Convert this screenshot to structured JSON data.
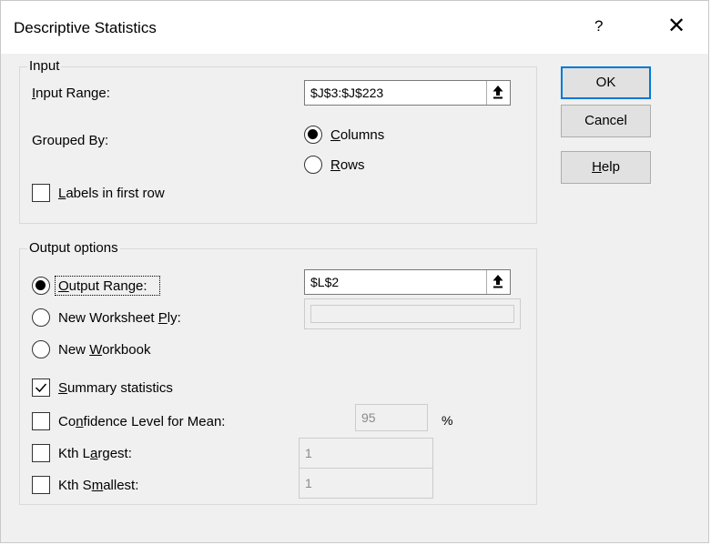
{
  "window": {
    "title": "Descriptive Statistics",
    "help_glyph": "?",
    "close_glyph": "✕"
  },
  "input_group": {
    "caption": "Input",
    "input_range_label_pre": "",
    "input_range_label_u": "I",
    "input_range_label_post": "nput Range:",
    "input_range_value": "$J$3:$J$223",
    "grouped_by_label": "Grouped By:",
    "columns_label_u": "C",
    "columns_label_post": "olumns",
    "columns_checked": true,
    "rows_label_u": "R",
    "rows_label_post": "ows",
    "rows_checked": false,
    "labels_label_u": "L",
    "labels_label_post": "abels in first row",
    "labels_checked": false
  },
  "output_group": {
    "caption": "Output options",
    "output_range_label_u": "O",
    "output_range_label_post": "utput Range:",
    "output_range_checked": true,
    "output_range_value": "$L$2",
    "new_ply_label_pre": "New Worksheet ",
    "new_ply_label_u": "P",
    "new_ply_label_post": "ly:",
    "new_ply_checked": false,
    "new_ply_value": "",
    "new_workbook_label_pre": "New ",
    "new_workbook_label_u": "W",
    "new_workbook_label_post": "orkbook",
    "new_workbook_checked": false,
    "summary_label_u": "S",
    "summary_label_post": "ummary statistics",
    "summary_checked": true,
    "confidence_label_pre": "Co",
    "confidence_label_u": "n",
    "confidence_label_post": "fidence Level for Mean:",
    "confidence_checked": false,
    "confidence_value": "95",
    "percent_sign": "%",
    "kth_largest_label_pre": "Kth L",
    "kth_largest_label_u": "a",
    "kth_largest_label_post": "rgest:",
    "kth_largest_checked": false,
    "kth_largest_value": "1",
    "kth_smallest_label_pre": "Kth S",
    "kth_smallest_label_u": "m",
    "kth_smallest_label_post": "allest:",
    "kth_smallest_checked": false,
    "kth_smallest_value": "1"
  },
  "buttons": {
    "ok": "OK",
    "cancel": "Cancel",
    "help_u": "H",
    "help_post": "elp"
  },
  "colors": {
    "dialog_bg": "#f0f0f0",
    "title_bg": "#ffffff",
    "default_button_border": "#0078d7"
  },
  "icons": {
    "collapse": "collapse-dialog-arrow-icon",
    "close": "close-icon",
    "help": "help-icon",
    "check": "checkmark-icon"
  }
}
